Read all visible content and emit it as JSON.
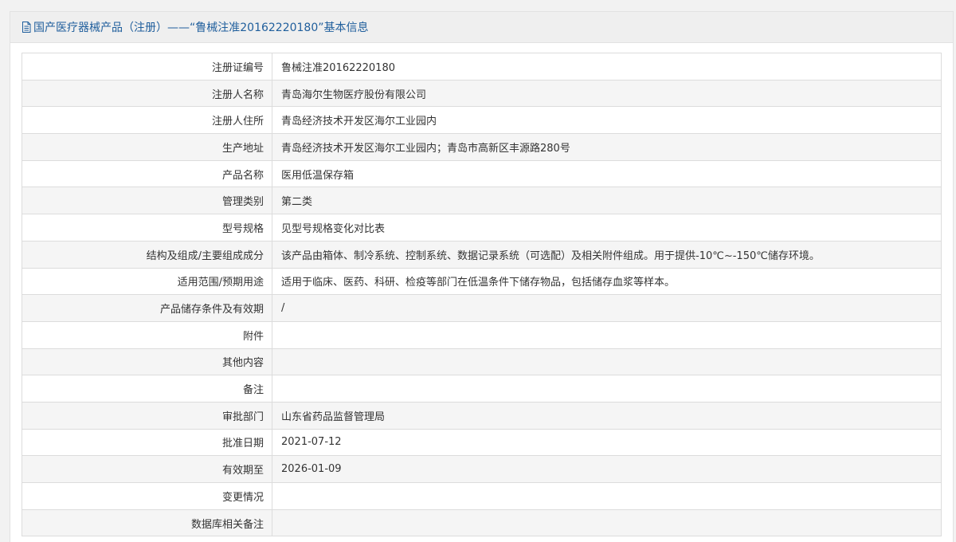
{
  "panel": {
    "title": "国产医疗器械产品（注册）——“鲁械注准20162220180”基本信息",
    "title_color": "#1f5e9c"
  },
  "rows": [
    {
      "label": "注册证编号",
      "value": "鲁械注准20162220180"
    },
    {
      "label": "注册人名称",
      "value": "青岛海尔生物医疗股份有限公司"
    },
    {
      "label": "注册人住所",
      "value": "青岛经济技术开发区海尔工业园内"
    },
    {
      "label": "生产地址",
      "value": "青岛经济技术开发区海尔工业园内；青岛市高新区丰源路280号"
    },
    {
      "label": "产品名称",
      "value": "医用低温保存箱"
    },
    {
      "label": "管理类别",
      "value": "第二类"
    },
    {
      "label": "型号规格",
      "value": "见型号规格变化对比表"
    },
    {
      "label": "结构及组成/主要组成成分",
      "value": "该产品由箱体、制冷系统、控制系统、数据记录系统（可选配）及相关附件组成。用于提供-10℃~-150℃储存环境。"
    },
    {
      "label": "适用范围/预期用途",
      "value": "适用于临床、医药、科研、检疫等部门在低温条件下储存物品，包括储存血浆等样本。"
    },
    {
      "label": "产品储存条件及有效期",
      "value": "/"
    },
    {
      "label": "附件",
      "value": ""
    },
    {
      "label": "其他内容",
      "value": ""
    },
    {
      "label": "备注",
      "value": ""
    },
    {
      "label": "审批部门",
      "value": "山东省药品监督管理局"
    },
    {
      "label": "批准日期",
      "value": "2021-07-12"
    },
    {
      "label": "有效期至",
      "value": "2026-01-09"
    },
    {
      "label": "变更情况",
      "value": ""
    },
    {
      "label": "数据库相关备注",
      "value": ""
    }
  ]
}
